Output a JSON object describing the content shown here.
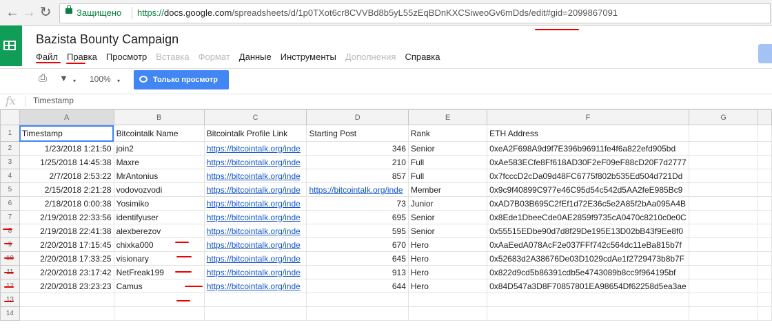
{
  "browser": {
    "back_icon": "arrow-left-icon",
    "forward_icon": "arrow-right-icon",
    "reload_icon": "reload-icon",
    "secure_label": "Защищено",
    "url_scheme": "https://",
    "url_host": "docs.google.com",
    "url_path": "/spreadsheets/d/1p0TXot6cr8CVVBd8b5yL55zEqBDnKXCSiweoGv6mDds",
    "url_tail": "/edit#gid=2099867091"
  },
  "doc": {
    "title": "Bazista Bounty Campaign"
  },
  "menu": [
    "Файл",
    "Правка",
    "Просмотр",
    "Вставка",
    "Формат",
    "Данные",
    "Инструменты",
    "Дополнения",
    "Справка"
  ],
  "toolbar": {
    "zoom": "100%",
    "view_only": "Только просмотр"
  },
  "formula": {
    "fx": "fx",
    "value": "Timestamp"
  },
  "columns": [
    "A",
    "B",
    "C",
    "D",
    "E",
    "F",
    "G"
  ],
  "headers": [
    "Timestamp",
    "Bitcointalk Name",
    "Bitcointalk Profile Link",
    "Starting Post",
    "Rank",
    "ETH Address"
  ],
  "rows": [
    {
      "timestamp": "1/23/2018 1:21:50",
      "name": "join2",
      "profile": "https://bitcointalk.org/inde",
      "post": "346",
      "rank": "Senior",
      "eth": "0xeA2F698A9d9f7E396b96911fe4f6a822efd905bd"
    },
    {
      "timestamp": "1/25/2018 14:45:38",
      "name": "Maxre",
      "profile": "https://bitcointalk.org/inde",
      "post": "210",
      "rank": "Full",
      "eth": "0xAe583ECfe8Ff618AD30F2eF09eF88cD20F7d2777"
    },
    {
      "timestamp": "2/7/2018 2:53:22",
      "name": "MrAntonius",
      "profile": "https://bitcointalk.org/inde",
      "post": "857",
      "rank": "Full",
      "eth": "0x7fcccD2cDa09d48FC6775f802b535Ed504d721Dd"
    },
    {
      "timestamp": "2/15/2018 2:21:28",
      "name": "vodovozvodi",
      "profile": "https://bitcointalk.org/inde",
      "post": "https://bitcointalk.org/inde",
      "rank": "Member",
      "eth": "0x9c9f40899C977e46C95d54c542d5AA2feE985Bc9"
    },
    {
      "timestamp": "2/18/2018 0:00:38",
      "name": "Yosimiko",
      "profile": "https://bitcointalk.org/inde",
      "post": "73",
      "rank": "Junior",
      "eth": "0xAD7B03B695C2fEf1d72E36c5e2A85f2bAa095A4B"
    },
    {
      "timestamp": "2/19/2018 22:33:56",
      "name": "identifyuser",
      "profile": "https://bitcointalk.org/inde",
      "post": "695",
      "rank": "Senior",
      "eth": "0x8Ede1DbeeCde0AE2859f9735cA0470c8210c0e0C"
    },
    {
      "timestamp": "2/19/2018 22:41:38",
      "name": "alexberezov",
      "profile": "https://bitcointalk.org/inde",
      "post": "595",
      "rank": "Senior",
      "eth": "0x55515EDbe90d7d8f29De195E13D02bB43f9Ee8f0"
    },
    {
      "timestamp": "2/20/2018 17:15:45",
      "name": "chixka000",
      "profile": "https://bitcointalk.org/inde",
      "post": "670",
      "rank": "Hero",
      "eth": "0xAaEedA078AcF2e037FFf742c564dc11eBa815b7f"
    },
    {
      "timestamp": "2/20/2018 17:33:25",
      "name": "visionary",
      "profile": "https://bitcointalk.org/inde",
      "post": "645",
      "rank": "Hero",
      "eth": "0x52683d2A38676De03D1029cdAe1f2729473b8b7F"
    },
    {
      "timestamp": "2/20/2018 23:17:42",
      "name": "NetFreak199",
      "profile": "https://bitcointalk.org/inde",
      "post": "913",
      "rank": "Hero",
      "eth": "0x822d9cd5b86391cdb5e4743089b8cc9f964195bf"
    },
    {
      "timestamp": "2/20/2018 23:23:23",
      "name": "Camus",
      "profile": "https://bitcointalk.org/inde",
      "post": "644",
      "rank": "Hero",
      "eth": "0x84D547a3D8F70857801EA98654Df62258d5ea3ae"
    }
  ],
  "row_numbers": [
    "1",
    "2",
    "3",
    "4",
    "5",
    "6",
    "7",
    "8",
    "9",
    "10",
    "11",
    "12",
    "13",
    "14"
  ],
  "colors": {
    "accent": "#4285f4",
    "sheets_green": "#0f9d58",
    "link": "#1155cc",
    "annotation_red": "#e00000"
  }
}
